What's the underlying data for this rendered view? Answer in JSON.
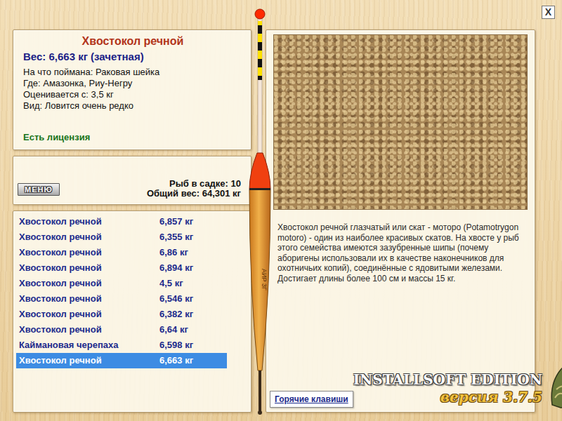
{
  "window": {
    "close": "X"
  },
  "catch": {
    "title": "Хвостокол речной",
    "weight": "Вес: 6,663 кг (зачетная)",
    "details": [
      "На что поймана: Раковая шейка",
      "Где: Амазонка, Риу-Негру",
      "Оценивается с: 3,5 кг",
      "Вид: Ловится очень редко"
    ],
    "license": "Есть лицензия"
  },
  "keepnet": {
    "menu_button": "МЕНЮ",
    "count": "Рыб в садке: 10",
    "total": "Общий вес: 64,301 кг"
  },
  "float_label": "АИР 3Г",
  "fish_list": [
    {
      "name": "Хвостокол речной",
      "weight": "6,857 кг",
      "selected": false
    },
    {
      "name": "Хвостокол речной",
      "weight": "6,355 кг",
      "selected": false
    },
    {
      "name": "Хвостокол речной",
      "weight": "6,86 кг",
      "selected": false
    },
    {
      "name": "Хвостокол речной",
      "weight": "6,894 кг",
      "selected": false
    },
    {
      "name": "Хвостокол речной",
      "weight": "4,5 кг",
      "selected": false
    },
    {
      "name": "Хвостокол речной",
      "weight": "6,546 кг",
      "selected": false
    },
    {
      "name": "Хвостокол речной",
      "weight": "6,382 кг",
      "selected": false
    },
    {
      "name": "Хвостокол речной",
      "weight": "6,64 кг",
      "selected": false
    },
    {
      "name": "Каймановая черепаха",
      "weight": "6,598 кг",
      "selected": false
    },
    {
      "name": "Хвостокол речной",
      "weight": "6,663 кг",
      "selected": true
    }
  ],
  "description": "Хвостокол речной глазчатый или скат - моторо (Potamotrygon motoro) - один из наиболее красивых скатов. На хвосте у рыб этого семейства имеются зазубренные шипы (почему аборигены использовали их в качестве наконечников для охотничьих копий), соединённые с ядовитыми железами. Достигает длины более 100 см и массы 15 кг.",
  "hotkeys_button": "Горячие клавиши",
  "branding": {
    "edition": "INSTALLSOFT EDITION",
    "version": "версия 3.7.5"
  }
}
